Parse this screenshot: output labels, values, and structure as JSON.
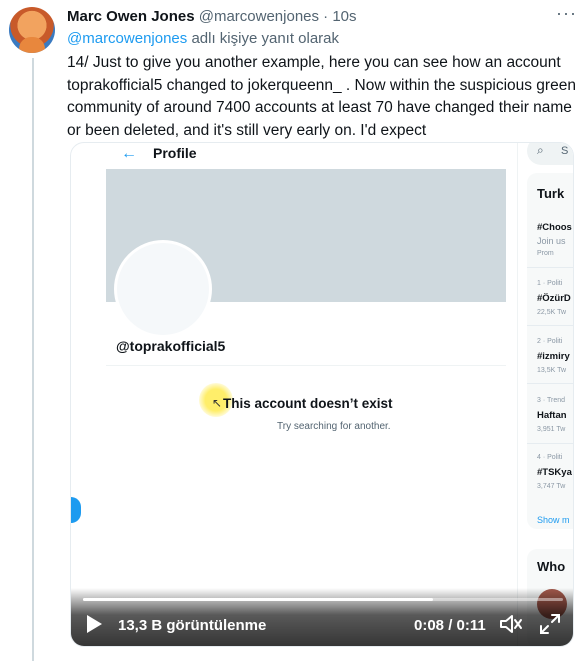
{
  "tweet": {
    "author_name": "Marc Owen Jones",
    "author_handle": "@marcowenjones",
    "separator": "·",
    "time": "10s",
    "more_icon": "more-horizontal-icon",
    "reply_mention": "@marcowenjones",
    "reply_suffix": "adlı kişiye yanıt olarak",
    "text": "14/ Just to give you another example, here you can see how an account toprakofficial5 changed to jokerqueenn_ . Now within the suspicious green community of around 7400 accounts at least 70 have changed their name or been deleted, and it's still very early on. I'd expect"
  },
  "video": {
    "profile_header_title": "Profile",
    "back_icon": "back-arrow-icon",
    "profile_handle": "@toprakofficial5",
    "not_exist_title": "This account doesn’t exist",
    "not_exist_subtitle": "Try searching for another.",
    "search_placeholder_fragment": "S",
    "trends_title_fragment": "Turk",
    "trends": [
      {
        "meta": "",
        "tag": "#Choos",
        "sub": "Join us",
        "extra": "Prom"
      },
      {
        "meta": "1 · Politi",
        "tag": "#ÖzürD",
        "count": "22,5K Tw"
      },
      {
        "meta": "2 · Politi",
        "tag": "#izmiry",
        "count": "13,5K Tw"
      },
      {
        "meta": "3 · Trend",
        "tag": "Haftan",
        "count": "3,951 Tw"
      },
      {
        "meta": "4 · Politi",
        "tag": "#TSKya",
        "count": "3,747 Tw"
      }
    ],
    "show_more_fragment": "Show m",
    "who_to_follow_fragment": "Who",
    "views": "13,3 B görüntülenme",
    "timer": "0:08 / 0:11",
    "progress_fraction": 0.73,
    "play_icon": "play-icon",
    "volume_icon": "volume-icon",
    "fullscreen_icon": "fullscreen-icon"
  },
  "colors": {
    "accent": "#1d9bf0",
    "text_primary": "#0f1419",
    "text_secondary": "#536471",
    "banner": "#cfd9de"
  }
}
